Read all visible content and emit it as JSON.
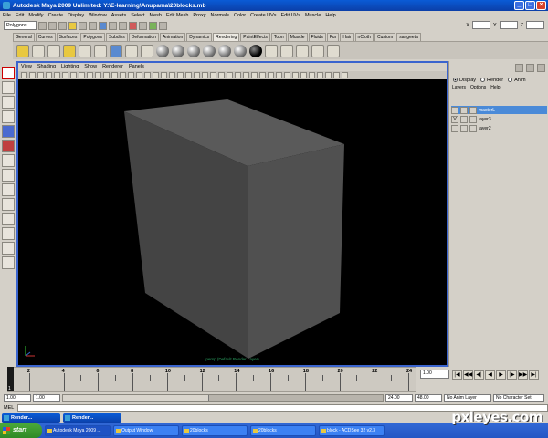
{
  "window": {
    "title": "Autodesk Maya 2009 Unlimited: Y:\\E-learning\\Anupama\\20blocks.mb"
  },
  "menubar": [
    "File",
    "Edit",
    "Modify",
    "Create",
    "Display",
    "Window",
    "Assets",
    "Select",
    "Mesh",
    "Edit Mesh",
    "Proxy",
    "Normals",
    "Color",
    "Create UVs",
    "Edit UVs",
    "Muscle",
    "Help"
  ],
  "status_line": {
    "menuset": "Polygons"
  },
  "coords": {
    "x": "X",
    "y": "Y",
    "z": "Z"
  },
  "shelf_tabs": [
    "General",
    "Curves",
    "Surfaces",
    "Polygons",
    "Subdivs",
    "Deformation",
    "Animation",
    "Dynamics",
    "Rendering",
    "PaintEffects",
    "Toon",
    "Muscle",
    "Fluids",
    "Fur",
    "Hair",
    "nCloth",
    "Custom",
    "sangeeta"
  ],
  "active_shelf_tab": "Rendering",
  "panel_menu": [
    "View",
    "Shading",
    "Lighting",
    "Show",
    "Renderer",
    "Panels"
  ],
  "viewport": {
    "camera_label": "persp (Default Render Layer)",
    "background": "#000000",
    "cube_color": "#4a4a4a"
  },
  "channel_box": {
    "radios": [
      "Display",
      "Render",
      "Anim"
    ],
    "menu": [
      "Layers",
      "Options",
      "Help"
    ],
    "layers": [
      {
        "visible": "",
        "name": "masterL",
        "selected": true
      },
      {
        "visible": "V",
        "name": "layer3",
        "selected": false
      },
      {
        "visible": "",
        "name": "layer2",
        "selected": false
      }
    ]
  },
  "time_slider": {
    "tick_labels": [
      "2",
      "4",
      "6",
      "8",
      "10",
      "12",
      "14",
      "16",
      "18",
      "20",
      "22",
      "24"
    ],
    "current_frame": "1",
    "frame_field": "1.00",
    "play_buttons": [
      "|◀",
      "◀◀",
      "◀|",
      "◀",
      "▶",
      "|▶",
      "▶▶",
      "▶|"
    ]
  },
  "range": {
    "start": "1.00",
    "playback_start": "1.00",
    "playback_end": "24.00",
    "end": "48.00",
    "anim_layer": "No Anim Layer",
    "character_set": "No Character Set"
  },
  "command_line": {
    "label": "MEL"
  },
  "minimized_windows": [
    "Render...",
    "Render..."
  ],
  "taskbar": {
    "start_label": "start",
    "tasks": [
      "Autodesk Maya 2009 ...",
      "Output Window",
      "20blocks",
      "20blocks",
      "block - ACDSee 32 v2.3"
    ]
  },
  "watermark": "pxleyes.com"
}
